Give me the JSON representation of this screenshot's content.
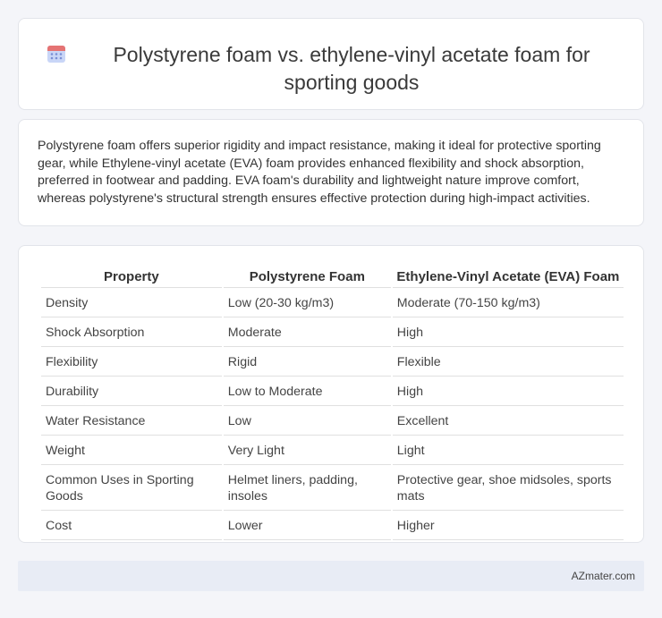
{
  "header": {
    "icon": "calendar-icon",
    "title": "Polystyrene foam vs. ethylene-vinyl acetate foam for sporting goods"
  },
  "description": "Polystyrene foam offers superior rigidity and impact resistance, making it ideal for protective sporting gear, while Ethylene-vinyl acetate (EVA) foam provides enhanced flexibility and shock absorption, preferred in footwear and padding. EVA foam's durability and lightweight nature improve comfort, whereas polystyrene's structural strength ensures effective protection during high-impact activities.",
  "table": {
    "headers": [
      "Property",
      "Polystyrene Foam",
      "Ethylene-Vinyl Acetate (EVA) Foam"
    ],
    "rows": [
      [
        "Density",
        "Low (20-30 kg/m3)",
        "Moderate (70-150 kg/m3)"
      ],
      [
        "Shock Absorption",
        "Moderate",
        "High"
      ],
      [
        "Flexibility",
        "Rigid",
        "Flexible"
      ],
      [
        "Durability",
        "Low to Moderate",
        "High"
      ],
      [
        "Water Resistance",
        "Low",
        "Excellent"
      ],
      [
        "Weight",
        "Very Light",
        "Light"
      ],
      [
        "Common Uses in Sporting Goods",
        "Helmet liners, padding, insoles",
        "Protective gear, shoe midsoles, sports mats"
      ],
      [
        "Cost",
        "Lower",
        "Higher"
      ]
    ]
  },
  "footer": {
    "brand": "AZmater.com"
  }
}
